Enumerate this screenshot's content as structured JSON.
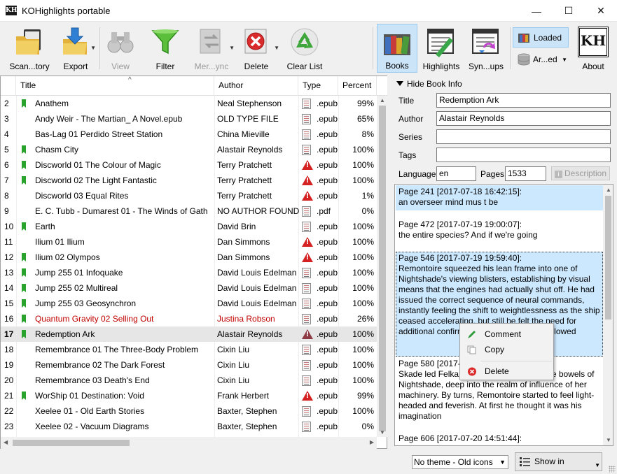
{
  "window": {
    "title": "KOHighlights portable",
    "app_icon_text": "KH",
    "minimize_glyph": "—",
    "maximize_glyph": "☐",
    "close_glyph": "✕"
  },
  "toolbar": {
    "scan": "Scan...tory",
    "export": "Export",
    "view": "View",
    "filter": "Filter",
    "merge": "Mer...ync",
    "delete": "Delete",
    "clear_list": "Clear List",
    "books": "Books",
    "highlights": "Highlights",
    "sync_groups": "Syn...ups",
    "loaded": "Loaded",
    "archived": "Ar...ed",
    "about": "About",
    "about_logo": "KH"
  },
  "table": {
    "sort_indicator": "^",
    "columns": [
      "Title",
      "Author",
      "Type",
      "Percent"
    ],
    "rows": [
      {
        "num": "2",
        "mark": "green",
        "title": "Anathem",
        "author": "Neal Stephenson",
        "status": "book",
        "ext": ".epub",
        "percent": "99%",
        "red": false,
        "selected": false
      },
      {
        "num": "3",
        "mark": "",
        "title": "Andy Weir - The Martian_ A Novel.epub",
        "author": "OLD TYPE FILE",
        "status": "book",
        "ext": ".epub",
        "percent": "65%",
        "red": false,
        "selected": false
      },
      {
        "num": "4",
        "mark": "",
        "title": "Bas-Lag 01 Perdido Street Station",
        "author": "China Mieville",
        "status": "book",
        "ext": ".epub",
        "percent": "8%",
        "red": false,
        "selected": false
      },
      {
        "num": "5",
        "mark": "green",
        "title": "Chasm City",
        "author": "Alastair Reynolds",
        "status": "book",
        "ext": ".epub",
        "percent": "100%",
        "red": false,
        "selected": false
      },
      {
        "num": "6",
        "mark": "green",
        "title": "Discworld 01 The Colour of Magic",
        "author": "Terry Pratchett",
        "status": "warn",
        "ext": ".epub",
        "percent": "100%",
        "red": false,
        "selected": false
      },
      {
        "num": "7",
        "mark": "green",
        "title": "Discworld 02 The Light Fantastic",
        "author": "Terry Pratchett",
        "status": "warn",
        "ext": ".epub",
        "percent": "100%",
        "red": false,
        "selected": false
      },
      {
        "num": "8",
        "mark": "",
        "title": "Discworld 03 Equal Rites",
        "author": "Terry Pratchett",
        "status": "warn",
        "ext": ".epub",
        "percent": "1%",
        "red": false,
        "selected": false
      },
      {
        "num": "9",
        "mark": "",
        "title": "E. C. Tubb - Dumarest 01 - The Winds of Gath",
        "author": "NO AUTHOR FOUND",
        "status": "book",
        "ext": ".pdf",
        "percent": "0%",
        "red": false,
        "selected": false
      },
      {
        "num": "10",
        "mark": "green",
        "title": "Earth",
        "author": "David Brin",
        "status": "book",
        "ext": ".epub",
        "percent": "100%",
        "red": false,
        "selected": false
      },
      {
        "num": "11",
        "mark": "",
        "title": "Ilium 01 Ilium",
        "author": "Dan Simmons",
        "status": "warn",
        "ext": ".epub",
        "percent": "100%",
        "red": false,
        "selected": false
      },
      {
        "num": "12",
        "mark": "green",
        "title": "Ilium 02 Olympos",
        "author": "Dan Simmons",
        "status": "warn",
        "ext": ".epub",
        "percent": "100%",
        "red": false,
        "selected": false
      },
      {
        "num": "13",
        "mark": "green",
        "title": "Jump 255 01 Infoquake",
        "author": "David Louis Edelman",
        "status": "book",
        "ext": ".epub",
        "percent": "100%",
        "red": false,
        "selected": false
      },
      {
        "num": "14",
        "mark": "green",
        "title": "Jump 255 02 Multireal",
        "author": "David Louis Edelman",
        "status": "book",
        "ext": ".epub",
        "percent": "100%",
        "red": false,
        "selected": false
      },
      {
        "num": "15",
        "mark": "green",
        "title": "Jump 255 03 Geosynchron",
        "author": "David Louis Edelman",
        "status": "book",
        "ext": ".epub",
        "percent": "100%",
        "red": false,
        "selected": false
      },
      {
        "num": "16",
        "mark": "green",
        "title": "Quantum Gravity 02 Selling Out",
        "author": "Justina Robson",
        "status": "book",
        "ext": ".epub",
        "percent": "26%",
        "red": true,
        "selected": false
      },
      {
        "num": "17",
        "mark": "green",
        "title": "Redemption Ark",
        "author": "Alastair Reynolds",
        "status": "warn-dim",
        "ext": ".epub",
        "percent": "100%",
        "red": false,
        "selected": true
      },
      {
        "num": "18",
        "mark": "",
        "title": "Remembrance 01 The Three-Body Problem",
        "author": "Cixin Liu",
        "status": "book",
        "ext": ".epub",
        "percent": "100%",
        "red": false,
        "selected": false
      },
      {
        "num": "19",
        "mark": "",
        "title": "Remembrance 02 The Dark Forest",
        "author": "Cixin Liu",
        "status": "book",
        "ext": ".epub",
        "percent": "100%",
        "red": false,
        "selected": false
      },
      {
        "num": "20",
        "mark": "",
        "title": "Remembrance 03 Death's End",
        "author": "Cixin Liu",
        "status": "book",
        "ext": ".epub",
        "percent": "100%",
        "red": false,
        "selected": false
      },
      {
        "num": "21",
        "mark": "green",
        "title": "WorShip 01 Destination: Void",
        "author": "Frank Herbert",
        "status": "warn",
        "ext": ".epub",
        "percent": "99%",
        "red": false,
        "selected": false
      },
      {
        "num": "22",
        "mark": "",
        "title": "Xeelee 01 - Old Earth Stories",
        "author": "Baxter, Stephen",
        "status": "book",
        "ext": ".epub",
        "percent": "100%",
        "red": false,
        "selected": false
      },
      {
        "num": "23",
        "mark": "",
        "title": "Xeelee 02 - Vacuum Diagrams",
        "author": "Baxter, Stephen",
        "status": "book",
        "ext": ".epub",
        "percent": "0%",
        "red": false,
        "selected": false
      }
    ]
  },
  "book_info": {
    "toggle_label": "Hide Book Info",
    "title_label": "Title",
    "title_value": "Redemption Ark",
    "author_label": "Author",
    "author_value": "Alastair Reynolds",
    "series_label": "Series",
    "series_value": "",
    "tags_label": "Tags",
    "tags_value": "",
    "language_label": "Language",
    "language_value": "en",
    "pages_label": "Pages",
    "pages_value": "1533",
    "description_button": "Description"
  },
  "highlights": [
    {
      "header": "Page 241 [2017-07-18 16:42:15]:",
      "text": "an overseer mind mus t be",
      "style": "blue"
    },
    {
      "header": "Page 472 [2017-07-19 19:00:07]:",
      "text": "the entire species? And if we're going",
      "style": "white"
    },
    {
      "header": "Page 546 [2017-07-19 19:59:40]:",
      "text": "Remontoire squeezed his lean frame into one of Nightshade's viewing blisters, establishing by visual means that the engines had actually shut off. He had issued the correct sequence of neural commands, instantly feeling the shift to weightlessness as the ship ceased accelerating, but still he felt the need for additional confirmation that it had been followed",
      "style": "blue-focus"
    },
    {
      "header": "Page 580 [2017-07-20 14:26:04]:",
      "text": "Skade led Felka and Clavain deep into the bowels of Nightshade, deep into the realm of influence of her machinery. By turns, Remontoire started to feel light-headed and feverish. At first he thought it was his imagination",
      "style": "white"
    },
    {
      "header": "Page 606 [2017-07-20 14:51:44]:",
      "text": "",
      "style": "white"
    }
  ],
  "context_menu": {
    "comment": "Comment",
    "copy": "Copy",
    "delete": "Delete"
  },
  "status_bar": {
    "theme": "No theme - Old icons",
    "show_in": "Show in Highlights"
  }
}
